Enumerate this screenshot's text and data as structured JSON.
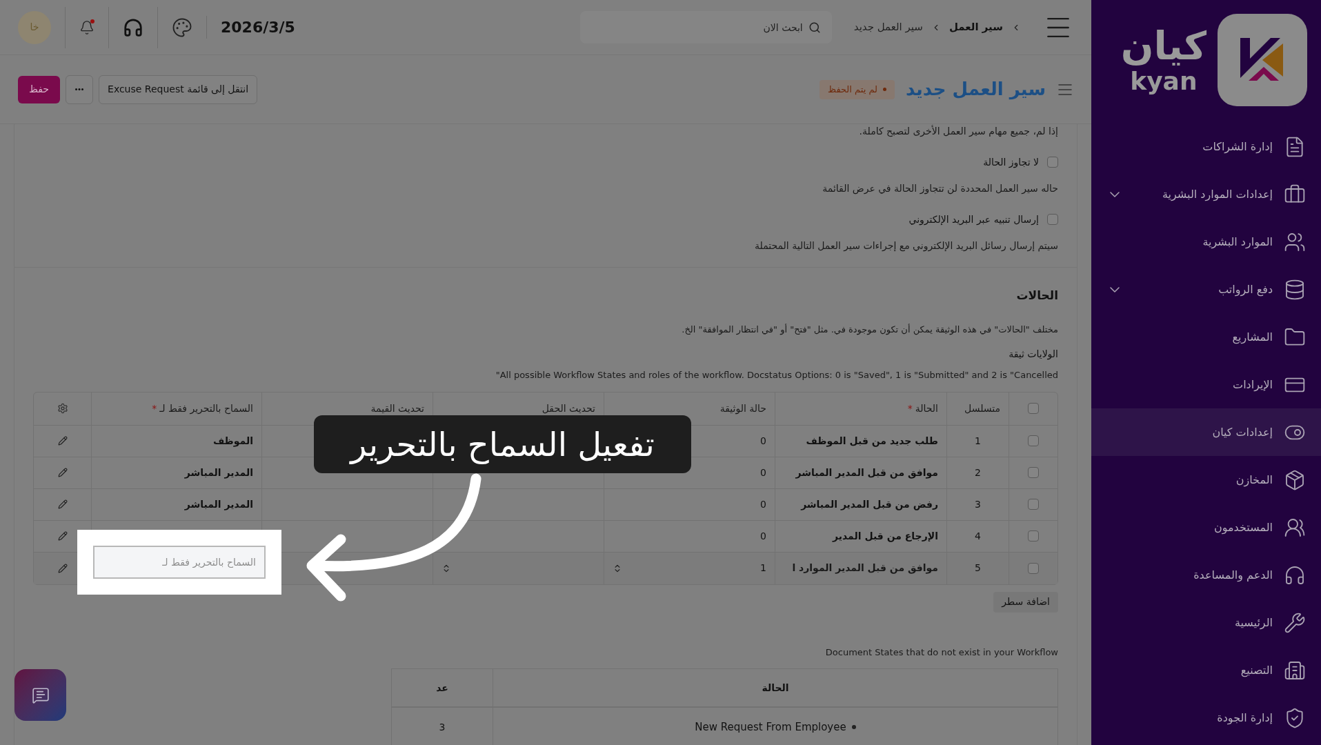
{
  "topbar": {
    "avatar": "خا",
    "has_unread": true,
    "date": "2026/3/5",
    "search": {
      "placeholder": "ابحث الان"
    },
    "breadcrumbs": [
      "سير العمل",
      "سير العمل جديد"
    ]
  },
  "header": {
    "title": "سير العمل جديد",
    "status": "لم يتم الحفظ",
    "goto_button": "انتقل إلى قائمة Excuse Request",
    "save_button": "حفظ"
  },
  "settings": [
    {
      "kind": "text",
      "text": "إذا لم، جميع مهام سير العمل الأخرى لتصبح كاملة."
    },
    {
      "kind": "checkbox",
      "label": "لا تجاوز الحالة",
      "checked": false
    },
    {
      "kind": "text",
      "text": "حاله سير العمل المحددة لن تتجاوز الحالة في عرض القائمة"
    },
    {
      "kind": "checkbox",
      "label": "إرسال تنبيه عبر البريد الإلكتروني",
      "checked": false
    },
    {
      "kind": "text",
      "text": "سيتم إرسال رسائل البريد الإلكتروني مع إجراءات سير العمل التالية المحتملة"
    }
  ],
  "states_section": {
    "title": "الحالات",
    "description": "مختلف \"الحالات\" في هذه الوثيقة يمكن أن تكون موجودة في. مثل \"فتح\" أو \"في انتظار الموافقة\" الخ.",
    "subtitle": "الولايات ثيقة",
    "note": "All possible Workflow States and roles of the workflow. Docstatus Options: 0 is \"Saved\", 1 is \"Submitted\" and 2 is \"Cancelled\""
  },
  "states_table": {
    "all_selected": false,
    "columns": [
      {
        "label": "متسلسل"
      },
      {
        "label": "الحالة",
        "required_mark": "*"
      },
      {
        "label": "حالة الوثيقة"
      },
      {
        "label": "تحديث الحقل"
      },
      {
        "label": "تحديث القيمة"
      },
      {
        "label": "السماح بالتحرير فقط لـ",
        "required_mark": "*"
      }
    ],
    "rows": [
      {
        "selected": false,
        "editing": false,
        "seq": "1",
        "state": "طلب جديد من قبل الموظف",
        "doc_status": "0",
        "allow_edit": "الموظف"
      },
      {
        "selected": false,
        "editing": false,
        "seq": "2",
        "state": "موافق من قبل المدير المباشر",
        "doc_status": "0",
        "allow_edit": "المدير المباشر"
      },
      {
        "selected": false,
        "editing": false,
        "seq": "3",
        "state": "رفض من قبل المدير المباشر",
        "doc_status": "0",
        "allow_edit": "المدير المباشر"
      },
      {
        "selected": false,
        "editing": false,
        "seq": "4",
        "state": "الإرجاع من قبل المدير",
        "doc_status": "0"
      },
      {
        "selected": false,
        "editing": true,
        "seq": "5",
        "state": "موافق من قبل المدير الموارد ا",
        "doc_status": "1",
        "allow_edit_placeholder": "السماح بالتحرير فقط لـ"
      }
    ],
    "add_row_button": "اضافة سطر"
  },
  "tutorial": {
    "caption": "تفعيل السماح بالتحرير"
  },
  "missing_states": {
    "note": "Document States that do not exist in your Workflow",
    "columns": [
      "الحالة",
      "عد"
    ],
    "rows": [
      {
        "state": "New Request From Employee",
        "count": "3"
      }
    ]
  },
  "sidebar": {
    "logo": {
      "arabic": "كيان",
      "latin": "kyan"
    },
    "items": [
      {
        "label": "إدارة الشراكات",
        "selected": false,
        "expandable": false
      },
      {
        "label": "إعدادات الموارد البشرية",
        "selected": false,
        "expandable": true
      },
      {
        "label": "الموارد البشرية",
        "selected": false,
        "expandable": false
      },
      {
        "label": "دفع الرواتب",
        "selected": false,
        "expandable": true
      },
      {
        "label": "المشاريع",
        "selected": false,
        "expandable": false
      },
      {
        "label": "الإيرادات",
        "selected": false,
        "expandable": false
      },
      {
        "label": "إعدادات كيان",
        "selected": true,
        "expandable": false
      },
      {
        "label": "المخازن",
        "selected": false,
        "expandable": false
      },
      {
        "label": "المستخدمون",
        "selected": false,
        "expandable": false
      },
      {
        "label": "الدعم والمساعدة",
        "selected": false,
        "expandable": false
      },
      {
        "label": "الرئيسية",
        "selected": false,
        "expandable": false
      },
      {
        "label": "التصنيع",
        "selected": false,
        "expandable": false
      },
      {
        "label": "إدارة الجودة",
        "selected": false,
        "expandable": false
      }
    ]
  }
}
